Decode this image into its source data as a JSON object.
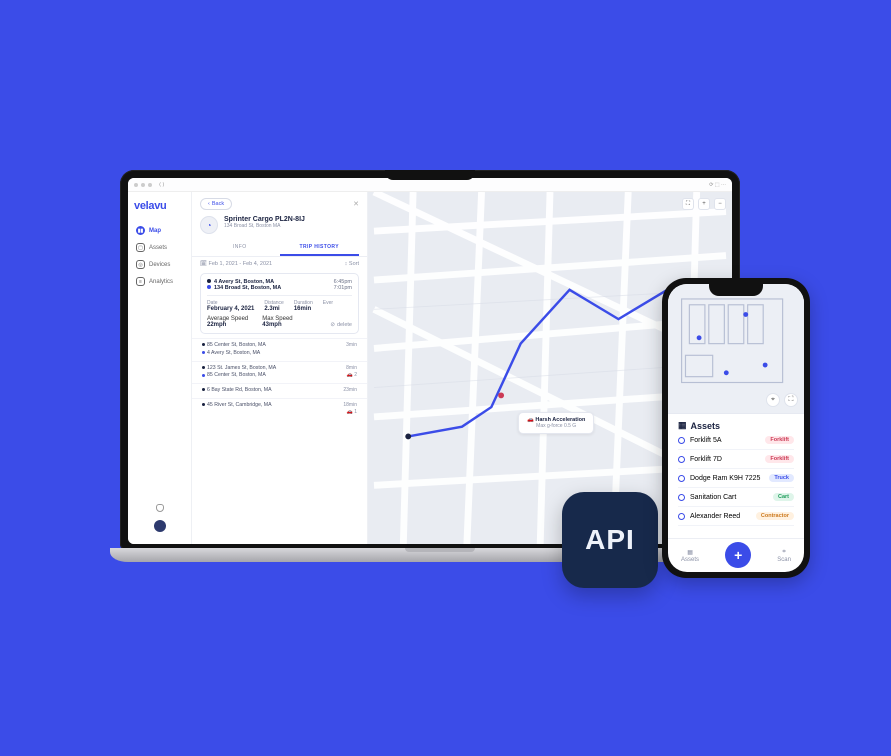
{
  "brand": "velavu",
  "sidebar": {
    "items": [
      {
        "label": "Map"
      },
      {
        "label": "Assets"
      },
      {
        "label": "Devices"
      },
      {
        "label": "Analytics"
      }
    ]
  },
  "panel": {
    "back": "Back",
    "asset_name": "Sprinter Cargo PL2N-8IJ",
    "asset_addr": "134 Broad St, Boston MA",
    "tab_info": "INFO",
    "tab_history": "TRIP HISTORY",
    "date_range": "Feb 1, 2021 - Feb 4, 2021",
    "sort": "Sort",
    "trip": {
      "start_addr": "4 Avery St, Boston, MA",
      "start_time": "6:45pm",
      "end_addr": "134 Broad St, Boston, MA",
      "end_time": "7:01pm",
      "date_label": "Date",
      "date_value": "February 4, 2021",
      "dist_label": "Distance",
      "dist_value": "2.3mi",
      "dur_label": "Duration",
      "dur_value": "16min",
      "ev_label": "Ever",
      "avg_label": "Average Speed",
      "avg_value": "22mph",
      "max_label": "Max Speed",
      "max_value": "43mph",
      "delete": "delete"
    },
    "rows": [
      {
        "a": "85 Center St, Boston, MA",
        "b": "4 Avery St, Boston, MA",
        "dur": "3min"
      },
      {
        "a": "123 St. James St, Boston, MA",
        "b": "85 Center St, Boston, MA",
        "dur": "8min",
        "veh": "2"
      },
      {
        "a": "6 Bay State Rd, Boston, MA",
        "b": "",
        "dur": "23min"
      },
      {
        "a": "45 River St, Cambridge, MA",
        "b": "",
        "dur": "18min",
        "veh": "1"
      }
    ]
  },
  "map": {
    "tooltip_title": "Harsh Acceleration",
    "tooltip_sub": "Max g-force 0.5 G"
  },
  "api_label": "API",
  "phone": {
    "assets_title": "Assets",
    "items": [
      {
        "name": "Forklift 5A",
        "tag": "Forklift",
        "cls": "forklift"
      },
      {
        "name": "Forklift 7D",
        "tag": "Forklift",
        "cls": "forklift"
      },
      {
        "name": "Dodge Ram K9H 7225",
        "tag": "Truck",
        "cls": "truck"
      },
      {
        "name": "Sanitation Cart",
        "tag": "Cart",
        "cls": "cart"
      },
      {
        "name": "Alexander Reed",
        "tag": "Contractor",
        "cls": "contractor"
      }
    ],
    "tab_assets": "Assets",
    "tab_scan": "Scan"
  }
}
